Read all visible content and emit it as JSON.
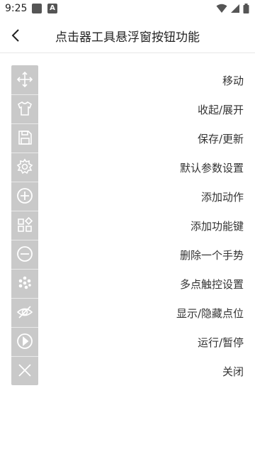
{
  "status_bar": {
    "time": "9:25",
    "a_badge": "A"
  },
  "header": {
    "title": "点击器工具悬浮窗按钮功能"
  },
  "menu": {
    "items": [
      {
        "label": "移动",
        "icon": "move-icon"
      },
      {
        "label": "收起/展开",
        "icon": "shirt-icon"
      },
      {
        "label": "保存/更新",
        "icon": "save-icon"
      },
      {
        "label": "默认参数设置",
        "icon": "gear-icon"
      },
      {
        "label": "添加动作",
        "icon": "add-circle-icon"
      },
      {
        "label": "添加功能键",
        "icon": "widgets-icon"
      },
      {
        "label": "删除一个手势",
        "icon": "remove-circle-icon"
      },
      {
        "label": "多点触控设置",
        "icon": "multi-dots-icon"
      },
      {
        "label": "显示/隐藏点位",
        "icon": "eye-icon"
      },
      {
        "label": "运行/暂停",
        "icon": "play-icon"
      },
      {
        "label": "关闭",
        "icon": "close-icon"
      }
    ]
  },
  "colors": {
    "panel_bg": "#c9c9c9",
    "icon": "#ffffff",
    "text": "#333333"
  }
}
